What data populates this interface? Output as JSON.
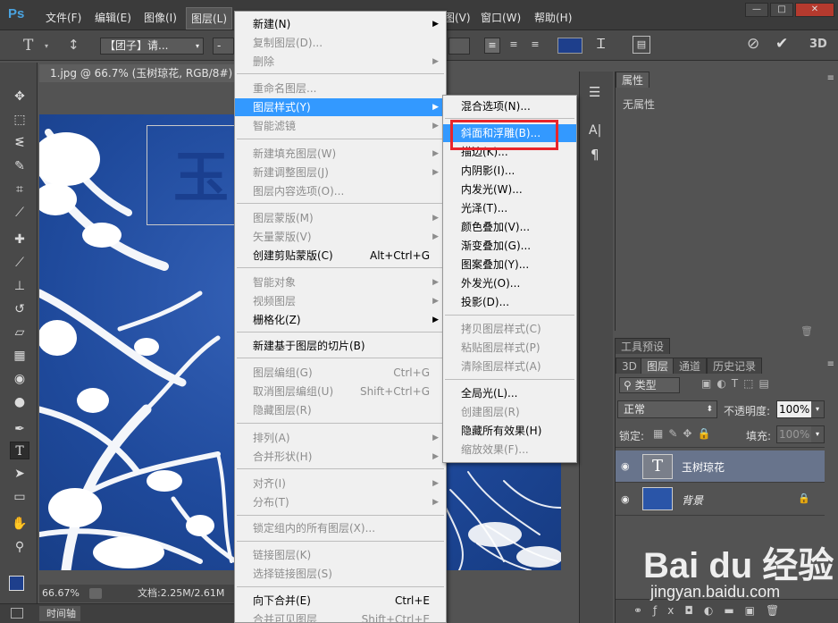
{
  "app": {
    "logo": "Ps"
  },
  "menubar": {
    "file": "文件(F)",
    "edit": "编辑(E)",
    "image": "图像(I)",
    "layer": "图层(L)",
    "view": "视图(V)",
    "window": "窗口(W)",
    "help": "帮助(H)"
  },
  "window_controls": {
    "minimize": "—",
    "maximize": "□",
    "close": "✕"
  },
  "options": {
    "font_family": "【团子】请...",
    "font_style": "-",
    "commit_icon": "check-icon",
    "cancel_icon": "cancel-icon",
    "threed": "3D"
  },
  "document": {
    "tab_title": "1.jpg @ 66.7% (玉树琼花, RGB/8#) *",
    "tab_close": "×",
    "zoom": "66.67%",
    "doc_info": "文档:2.25M/2.61M",
    "timeline": "时间轴",
    "canvas_glyph": "玉"
  },
  "layer_menu": {
    "items": [
      {
        "label": "新建(N)",
        "arrow": true,
        "disabled": false
      },
      {
        "label": "复制图层(D)...",
        "disabled": true
      },
      {
        "label": "删除",
        "arrow": true,
        "disabled": true
      },
      {
        "label": "重命名图层...",
        "disabled": true
      },
      {
        "label": "图层样式(Y)",
        "arrow": true,
        "highlighted": true
      },
      {
        "label": "智能滤镜",
        "arrow": true,
        "disabled": true
      },
      {
        "label": "新建填充图层(W)",
        "arrow": true,
        "disabled": true
      },
      {
        "label": "新建调整图层(J)",
        "arrow": true,
        "disabled": true
      },
      {
        "label": "图层内容选项(O)...",
        "disabled": true
      },
      {
        "label": "图层蒙版(M)",
        "arrow": true,
        "disabled": true
      },
      {
        "label": "矢量蒙版(V)",
        "arrow": true,
        "disabled": true
      },
      {
        "label": "创建剪贴蒙版(C)",
        "shortcut": "Alt+Ctrl+G",
        "disabled": false
      },
      {
        "label": "智能对象",
        "arrow": true,
        "disabled": true
      },
      {
        "label": "视频图层",
        "arrow": true,
        "disabled": true
      },
      {
        "label": "栅格化(Z)",
        "arrow": true,
        "disabled": false
      },
      {
        "label": "新建基于图层的切片(B)",
        "disabled": false
      },
      {
        "label": "图层编组(G)",
        "shortcut": "Ctrl+G",
        "disabled": true
      },
      {
        "label": "取消图层编组(U)",
        "shortcut": "Shift+Ctrl+G",
        "disabled": true
      },
      {
        "label": "隐藏图层(R)",
        "disabled": true
      },
      {
        "label": "排列(A)",
        "arrow": true,
        "disabled": true
      },
      {
        "label": "合并形状(H)",
        "arrow": true,
        "disabled": true
      },
      {
        "label": "对齐(I)",
        "arrow": true,
        "disabled": true
      },
      {
        "label": "分布(T)",
        "arrow": true,
        "disabled": true
      },
      {
        "label": "锁定组内的所有图层(X)...",
        "disabled": true
      },
      {
        "label": "链接图层(K)",
        "disabled": true
      },
      {
        "label": "选择链接图层(S)",
        "disabled": true
      },
      {
        "label": "向下合并(E)",
        "shortcut": "Ctrl+E",
        "disabled": false
      },
      {
        "label": "合并可见图层",
        "shortcut": "Shift+Ctrl+E",
        "disabled": true
      }
    ]
  },
  "style_submenu": {
    "items": [
      {
        "label": "混合选项(N)...",
        "disabled": false
      },
      {
        "label": "斜面和浮雕(B)...",
        "highlighted": true
      },
      {
        "label": "描边(K)...",
        "disabled": false
      },
      {
        "label": "内阴影(I)...",
        "disabled": false
      },
      {
        "label": "内发光(W)...",
        "disabled": false
      },
      {
        "label": "光泽(T)...",
        "disabled": false
      },
      {
        "label": "颜色叠加(V)...",
        "disabled": false
      },
      {
        "label": "渐变叠加(G)...",
        "disabled": false
      },
      {
        "label": "图案叠加(Y)...",
        "disabled": false
      },
      {
        "label": "外发光(O)...",
        "disabled": false
      },
      {
        "label": "投影(D)...",
        "disabled": false
      },
      {
        "label": "拷贝图层样式(C)",
        "disabled": true
      },
      {
        "label": "粘贴图层样式(P)",
        "disabled": true
      },
      {
        "label": "清除图层样式(A)",
        "disabled": true
      },
      {
        "label": "全局光(L)...",
        "disabled": false
      },
      {
        "label": "创建图层(R)",
        "disabled": true
      },
      {
        "label": "隐藏所有效果(H)",
        "disabled": false
      },
      {
        "label": "缩放效果(F)...",
        "disabled": true
      }
    ]
  },
  "properties_panel": {
    "tab": "属性",
    "empty_text": "无属性"
  },
  "tool_presets_tab": "工具预设",
  "layers_panel": {
    "tabs": [
      "3D",
      "图层",
      "通道",
      "历史记录"
    ],
    "active_tab": "图层",
    "filter_label": "类型",
    "blend_mode": "正常",
    "opacity_label": "不透明度:",
    "opacity_value": "100%",
    "lock_label": "锁定:",
    "fill_label": "填充:",
    "fill_value": "100%",
    "layers": [
      {
        "name": "玉树琼花",
        "kind": "text",
        "thumb": "T",
        "selected": true
      },
      {
        "name": "背景",
        "kind": "image",
        "locked": true,
        "selected": false
      }
    ]
  },
  "watermark": {
    "brand": "Bai du 经验",
    "url": "jingyan.baidu.com"
  },
  "colors": {
    "highlight": "#3399ff",
    "red_box": "#e8252b",
    "foreground": "#1e3f8c",
    "background": "#ffffff"
  }
}
